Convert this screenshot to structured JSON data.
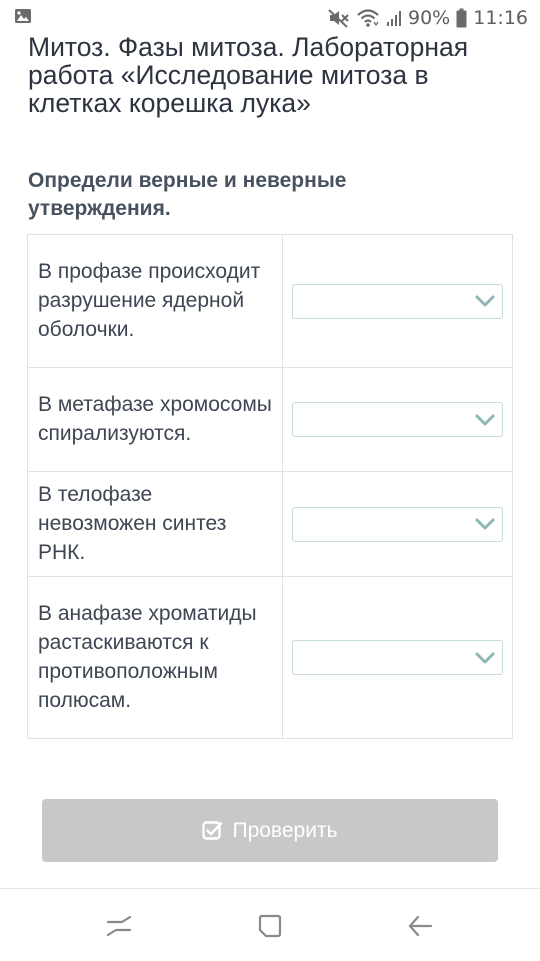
{
  "status_bar": {
    "notification_icon": "image-icon",
    "mute_icon": "muted-speaker-icon",
    "wifi_icon": "wifi-icon",
    "signal_icon": "signal-bars-icon",
    "battery_percent": "90%",
    "battery_icon": "battery-icon",
    "time": "11:16"
  },
  "page": {
    "title": "Митоз. Фазы митоза. Лабораторная работа «Исследование митоза в клетках корешка лука»",
    "instruction": "Определи верные и неверные утверждения."
  },
  "questions": [
    {
      "statement": "В профазе происходит разрушение ядерной оболочки.",
      "selected": ""
    },
    {
      "statement": "В метафазе хромосомы спирализуются.",
      "selected": ""
    },
    {
      "statement": "В телофазе невозможен синтез РНК.",
      "selected": ""
    },
    {
      "statement": "В анафазе хроматиды растаскиваются к противоположным полюсам.",
      "selected": ""
    }
  ],
  "check_button": {
    "label": "Проверить",
    "icon": "checkbox-checked-icon"
  },
  "nav_bar": {
    "recent_icon": "recent-apps-icon",
    "home_icon": "home-icon",
    "back_icon": "back-arrow-icon"
  },
  "colors": {
    "button_disabled": "#c8c8c8",
    "select_border": "#c7dcdc",
    "chevron": "#8fb6b6",
    "table_border": "#dde3e8"
  }
}
